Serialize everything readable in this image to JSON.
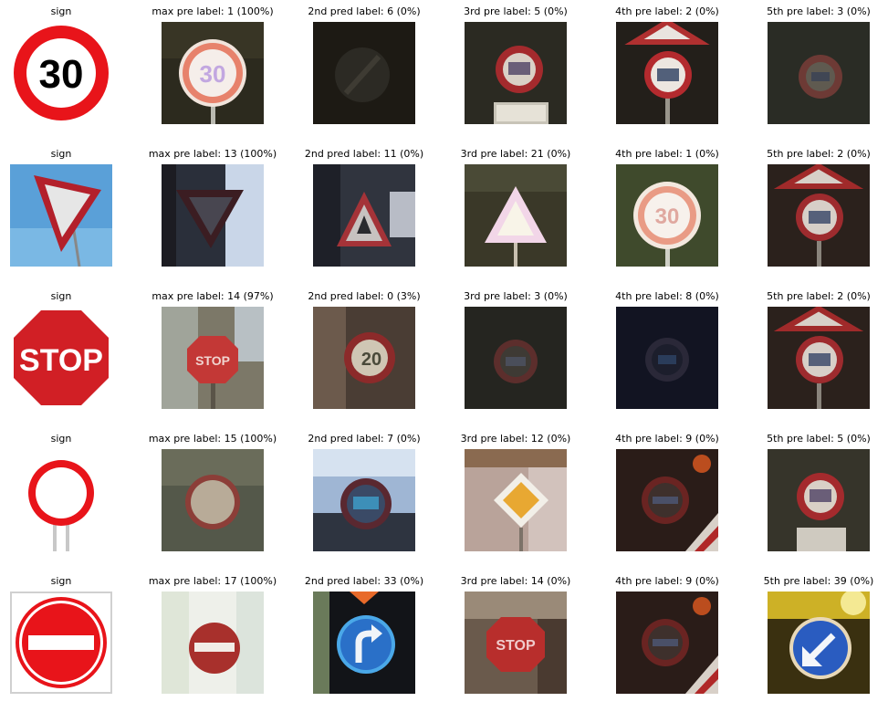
{
  "rows": [
    {
      "captions": [
        "sign",
        "max pre label: 1 (100%)",
        "2nd pred label: 6 (0%)",
        "3rd pre label: 5 (0%)",
        "4th pre label: 2 (0%)",
        "5th pre label: 3 (0%)"
      ]
    },
    {
      "captions": [
        "sign",
        "max pre label: 13 (100%)",
        "2nd pred label: 11 (0%)",
        "3rd pre label: 21 (0%)",
        "4th pre label: 1 (0%)",
        "5th pre label: 2 (0%)"
      ]
    },
    {
      "captions": [
        "sign",
        "max pre label: 14 (97%)",
        "2nd pred label: 0 (3%)",
        "3rd pre label: 3 (0%)",
        "4th pre label: 8 (0%)",
        "5th pre label: 2 (0%)"
      ]
    },
    {
      "captions": [
        "sign",
        "max pre label: 15 (100%)",
        "2nd pred label: 7 (0%)",
        "3rd pre label: 12 (0%)",
        "4th pre label: 9 (0%)",
        "5th pre label: 5 (0%)"
      ]
    },
    {
      "captions": [
        "sign",
        "max pre label: 17 (100%)",
        "2nd pred label: 33 (0%)",
        "3rd pre label: 14 (0%)",
        "4th pre label: 9 (0%)",
        "5th pre label: 39 (0%)"
      ]
    }
  ],
  "sign_text": {
    "speed": "30",
    "stop": "STOP"
  },
  "thumb_text": {
    "speed_30": "30",
    "speed_20": "20",
    "stop": "STOP"
  },
  "colors": {
    "sign_red": "#e8141a",
    "stop_red": "#d11f25",
    "yield_red": "#b3202b",
    "sky_blue": "#5aa0d8",
    "blue_sign": "#2a66c9"
  }
}
